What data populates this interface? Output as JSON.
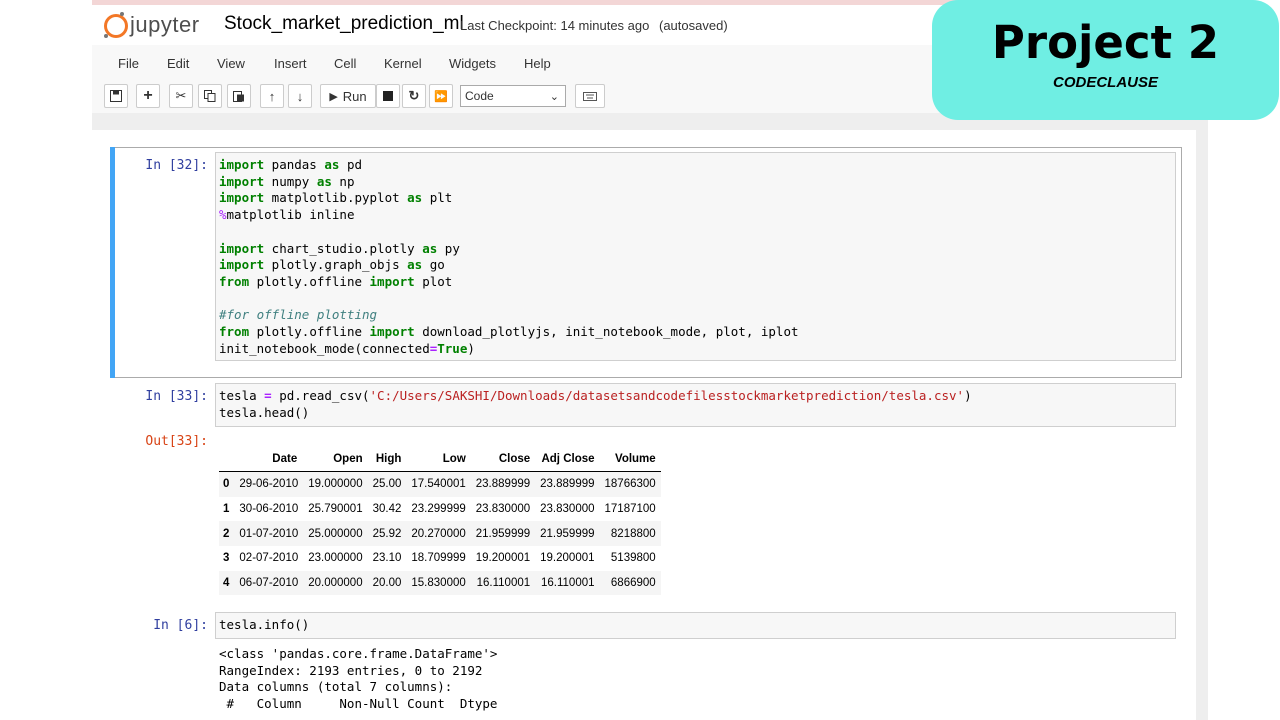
{
  "header": {
    "logo_text": "jupyter",
    "notebook_title": "Stock_market_prediction_ml",
    "checkpoint_label": "Last Checkpoint:",
    "checkpoint_time": "14 minutes ago",
    "autosave": "(autosaved)"
  },
  "menu": [
    "File",
    "Edit",
    "View",
    "Insert",
    "Cell",
    "Kernel",
    "Widgets",
    "Help"
  ],
  "toolbar": {
    "run_label": "Run",
    "cell_type": "Code",
    "icons": [
      "save-icon",
      "plus-icon",
      "cut-icon",
      "copy-icon",
      "paste-icon",
      "arrow-up-icon",
      "arrow-down-icon",
      "run-icon",
      "stop-icon",
      "restart-icon",
      "fast-forward-icon",
      "keyboard-icon"
    ]
  },
  "badge": {
    "title": "Project 2",
    "subtitle": "CODECLAUSE",
    "color": "#6feee3"
  },
  "cells": [
    {
      "prompt": "In [32]:",
      "lines": [
        "import pandas as pd",
        "import numpy as np",
        "import matplotlib.pyplot as plt",
        "%matplotlib inline",
        "",
        "import chart_studio.plotly as py",
        "import plotly.graph_objs as go",
        "from plotly.offline import plot",
        "",
        "#for offline plotting",
        "from plotly.offline import download_plotlyjs, init_notebook_mode, plot, iplot",
        "init_notebook_mode(connected=True)"
      ]
    },
    {
      "prompt": "In [33]:",
      "lines": [
        "tesla = pd.read_csv('C:/Users/SAKSHI/Downloads/datasetsandcodefilesstockmarketprediction/tesla.csv')",
        "tesla.head()"
      ],
      "out_prompt": "Out[33]:",
      "table": {
        "columns": [
          "",
          "Date",
          "Open",
          "High",
          "Low",
          "Close",
          "Adj Close",
          "Volume"
        ],
        "rows": [
          [
            "0",
            "29-06-2010",
            "19.000000",
            "25.00",
            "17.540001",
            "23.889999",
            "23.889999",
            "18766300"
          ],
          [
            "1",
            "30-06-2010",
            "25.790001",
            "30.42",
            "23.299999",
            "23.830000",
            "23.830000",
            "17187100"
          ],
          [
            "2",
            "01-07-2010",
            "25.000000",
            "25.92",
            "20.270000",
            "21.959999",
            "21.959999",
            "8218800"
          ],
          [
            "3",
            "02-07-2010",
            "23.000000",
            "23.10",
            "18.709999",
            "19.200001",
            "19.200001",
            "5139800"
          ],
          [
            "4",
            "06-07-2010",
            "20.000000",
            "20.00",
            "15.830000",
            "16.110001",
            "16.110001",
            "6866900"
          ]
        ]
      }
    },
    {
      "prompt": "In [6]:",
      "lines": [
        "tesla.info()"
      ],
      "output_lines": [
        "<class 'pandas.core.frame.DataFrame'>",
        "RangeIndex: 2193 entries, 0 to 2192",
        "Data columns (total 7 columns):",
        " #   Column     Non-Null Count  Dtype"
      ]
    }
  ]
}
